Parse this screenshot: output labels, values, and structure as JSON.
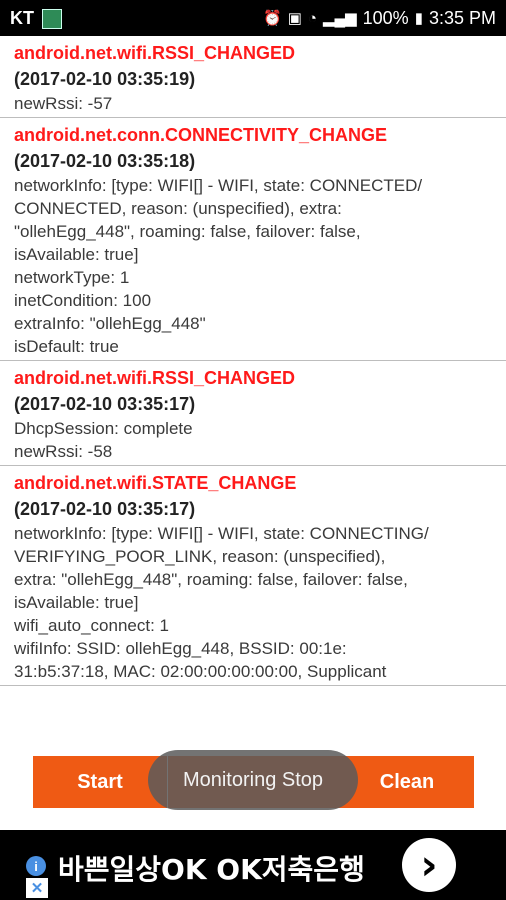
{
  "status_bar": {
    "carrier": "KT",
    "battery": "100%",
    "time": "3:35 PM",
    "icons": [
      "alarm-icon",
      "nfc-icon",
      "wifi-icon",
      "signal-icon",
      "battery-icon"
    ]
  },
  "log": {
    "entries": [
      {
        "action": "android.net.wifi.RSSI_CHANGED",
        "time": "(2017-02-10 03:35:19)",
        "lines": [
          "newRssi: -57"
        ]
      },
      {
        "action": "android.net.conn.CONNECTIVITY_CHANGE",
        "time": "(2017-02-10 03:35:18)",
        "lines": [
          "networkInfo: [type: WIFI[] - WIFI, state: CONNECTED/\nCONNECTED, reason: (unspecified), extra:\n\"ollehEgg_448\", roaming: false, failover: false,\nisAvailable: true]",
          "networkType: 1",
          "inetCondition: 100",
          "extraInfo: \"ollehEgg_448\"",
          "isDefault: true"
        ]
      },
      {
        "action": "android.net.wifi.RSSI_CHANGED",
        "time": "(2017-02-10 03:35:17)",
        "lines": [
          "DhcpSession: complete",
          "newRssi: -58"
        ]
      },
      {
        "action": "android.net.wifi.STATE_CHANGE",
        "time": "(2017-02-10 03:35:17)",
        "lines": [
          "networkInfo: [type: WIFI[] - WIFI, state: CONNECTING/\nVERIFYING_POOR_LINK, reason: (unspecified),\nextra: \"ollehEgg_448\", roaming: false, failover: false,\nisAvailable: true]",
          "wifi_auto_connect: 1",
          "wifiInfo: SSID: ollehEgg_448, BSSID: 00:1e:\n31:b5:37:18, MAC: 02:00:00:00:00:00, Supplicant"
        ]
      }
    ]
  },
  "controls": {
    "start_label": "Start",
    "stop_label": "Monitoring Stop",
    "clean_label": "Clean"
  },
  "ad": {
    "text": "바쁜일상OK OK저축은행",
    "info_glyph": "i",
    "close_glyph": "✕",
    "arrow_glyph": "›"
  },
  "colors": {
    "accent": "#ef5a14",
    "action_text": "#ff1a1a"
  }
}
